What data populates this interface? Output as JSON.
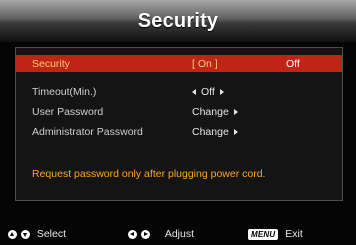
{
  "header": {
    "title": "Security"
  },
  "menu": {
    "items": [
      {
        "label": "Security",
        "value_bracket": "[  On  ]",
        "value_alt": "Off"
      },
      {
        "label": "Timeout(Min.)",
        "value": "Off"
      },
      {
        "label": "User Password",
        "value": "Change"
      },
      {
        "label": "Administrator Password",
        "value": "Change"
      }
    ],
    "note": "Request password only after plugging power cord."
  },
  "footer": {
    "select_label": "Select",
    "adjust_label": "Adjust",
    "menu_key": "MENU",
    "exit_label": "Exit"
  },
  "colors": {
    "selected_bg": "#bf2417",
    "selected_text": "#f8d070",
    "note_text": "#ffa41c"
  }
}
